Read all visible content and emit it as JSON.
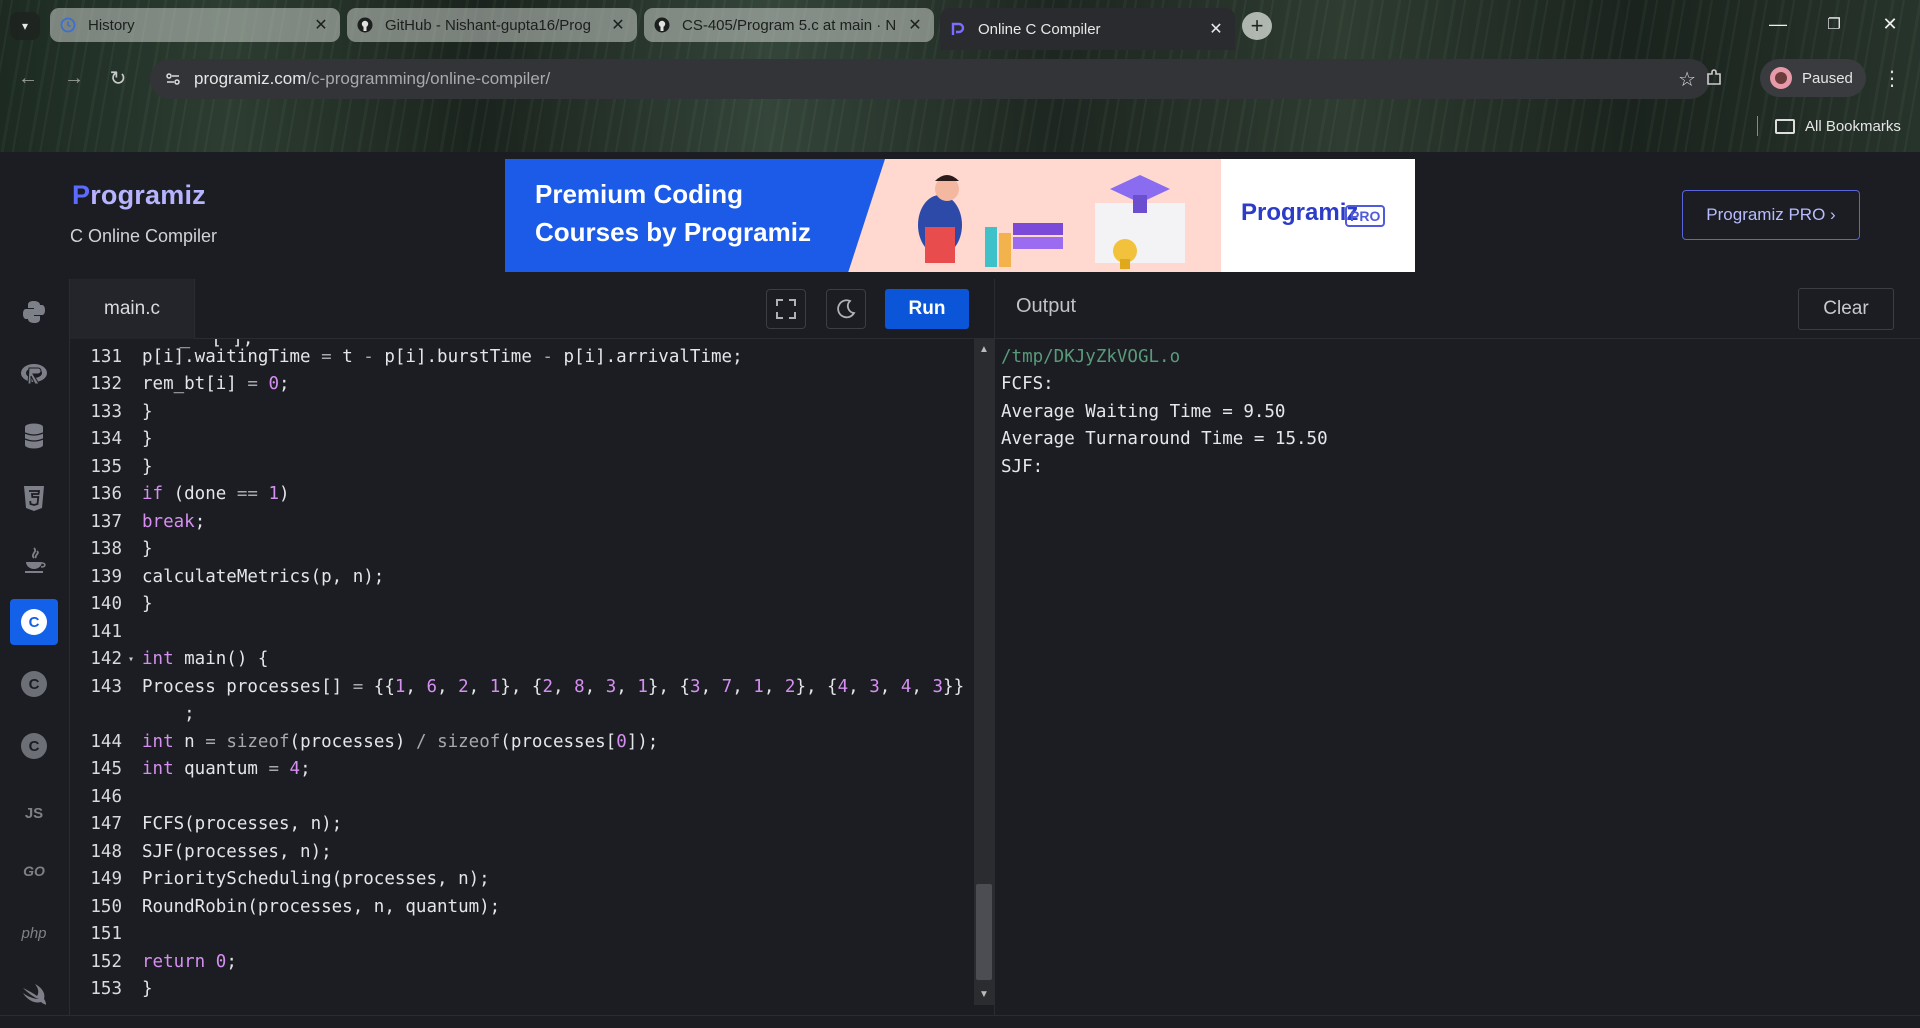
{
  "browser": {
    "tabs": [
      {
        "title": "History",
        "icon": "history-icon",
        "active": false
      },
      {
        "title": "GitHub - Nishant-gupta16/Prog",
        "icon": "github-icon",
        "active": false
      },
      {
        "title": "CS-405/Program 5.c at main · N",
        "icon": "github-icon",
        "active": false
      },
      {
        "title": "Online C Compiler",
        "icon": "programiz-icon",
        "active": true
      }
    ],
    "url_host": "programiz.com",
    "url_path": "/c-programming/online-compiler/",
    "profile_label": "Paused",
    "bookmarks_label": "All Bookmarks"
  },
  "header": {
    "logo_text": "rogramiz",
    "logo_p": "P",
    "subtitle": "C Online Compiler",
    "banner_line1": "Premium Coding",
    "banner_line2": "Courses by Programiz",
    "banner_brand": "Programiz",
    "banner_pro": "PRO",
    "pro_button": "Programiz PRO ›"
  },
  "rail": [
    {
      "name": "python",
      "label": "",
      "active": false
    },
    {
      "name": "r",
      "label": "R",
      "active": false
    },
    {
      "name": "sql",
      "label": "",
      "active": false
    },
    {
      "name": "html",
      "label": "5",
      "active": false
    },
    {
      "name": "java",
      "label": "",
      "active": false
    },
    {
      "name": "c",
      "label": "C",
      "active": true
    },
    {
      "name": "cpp",
      "label": "C",
      "active": false
    },
    {
      "name": "csharp",
      "label": "C",
      "active": false
    },
    {
      "name": "js",
      "label": "JS",
      "active": false
    },
    {
      "name": "go",
      "label": "GO",
      "active": false
    },
    {
      "name": "php",
      "label": "php",
      "active": false
    },
    {
      "name": "swift",
      "label": "",
      "active": false
    }
  ],
  "editor": {
    "filename": "main.c",
    "run_label": "Run",
    "fullscreen_icon": "fullscreen-icon",
    "theme_icon": "moon-icon",
    "lines": [
      {
        "n": "131",
        "html": "p[i].waitingTime <span class='o'>=</span> t <span class='o'>-</span> p[i].burstTime <span class='o'>-</span> p[i].arrivalTime;"
      },
      {
        "n": "132",
        "html": "rem_bt[i] <span class='o'>=</span> <span class='n'>0</span>;"
      },
      {
        "n": "133",
        "html": "}"
      },
      {
        "n": "134",
        "html": "}"
      },
      {
        "n": "135",
        "html": "}"
      },
      {
        "n": "136",
        "html": "<span class='k'>if</span> (done <span class='o'>==</span> <span class='n'>1</span>)"
      },
      {
        "n": "137",
        "html": "<span class='k'>break</span>;"
      },
      {
        "n": "138",
        "html": "}"
      },
      {
        "n": "139",
        "html": "calculateMetrics(p, n);"
      },
      {
        "n": "140",
        "html": "}"
      },
      {
        "n": "141",
        "html": ""
      },
      {
        "n": "142",
        "fold": true,
        "html": "<span class='k'>int</span> main() {"
      },
      {
        "n": "143",
        "html": "Process processes[] <span class='o'>=</span> {{<span class='n'>1</span>, <span class='n'>6</span>, <span class='n'>2</span>, <span class='n'>1</span>}, {<span class='n'>2</span>, <span class='n'>8</span>, <span class='n'>3</span>, <span class='n'>1</span>}, {<span class='n'>3</span>, <span class='n'>7</span>, <span class='n'>1</span>, <span class='n'>2</span>}, {<span class='n'>4</span>, <span class='n'>3</span>, <span class='n'>4</span>, <span class='n'>3</span>}}"
      },
      {
        "n": "",
        "html": "    ;"
      },
      {
        "n": "144",
        "html": "<span class='k'>int</span> n <span class='o'>=</span> <span class='kw2'>sizeof</span>(processes) <span class='o'>/</span> <span class='kw2'>sizeof</span>(processes[<span class='n'>0</span>]);"
      },
      {
        "n": "145",
        "html": "<span class='k'>int</span> quantum <span class='o'>=</span> <span class='n'>4</span>;"
      },
      {
        "n": "146",
        "html": ""
      },
      {
        "n": "147",
        "html": "FCFS(processes, n);"
      },
      {
        "n": "148",
        "html": "SJF(processes, n);"
      },
      {
        "n": "149",
        "html": "PriorityScheduling(processes, n);"
      },
      {
        "n": "150",
        "html": "RoundRobin(processes, n, quantum);"
      },
      {
        "n": "151",
        "html": ""
      },
      {
        "n": "152",
        "html": "<span class='k'>return</span> <span class='n'>0</span>;"
      },
      {
        "n": "153",
        "html": "}"
      }
    ]
  },
  "output": {
    "title": "Output",
    "clear_label": "Clear",
    "lines": [
      {
        "text": "/tmp/DKJyZkVOGL.o",
        "kind": "path"
      },
      {
        "text": "FCFS:",
        "kind": "text"
      },
      {
        "text": "Average Waiting Time = 9.50",
        "kind": "text"
      },
      {
        "text": "Average Turnaround Time = 15.50",
        "kind": "text"
      },
      {
        "text": "SJF:",
        "kind": "text"
      }
    ]
  },
  "colors": {
    "run_button": "#0b56d8",
    "active_language": "#1261e8",
    "keyword": "#d58ff0",
    "output_path": "#5a9a7a"
  }
}
